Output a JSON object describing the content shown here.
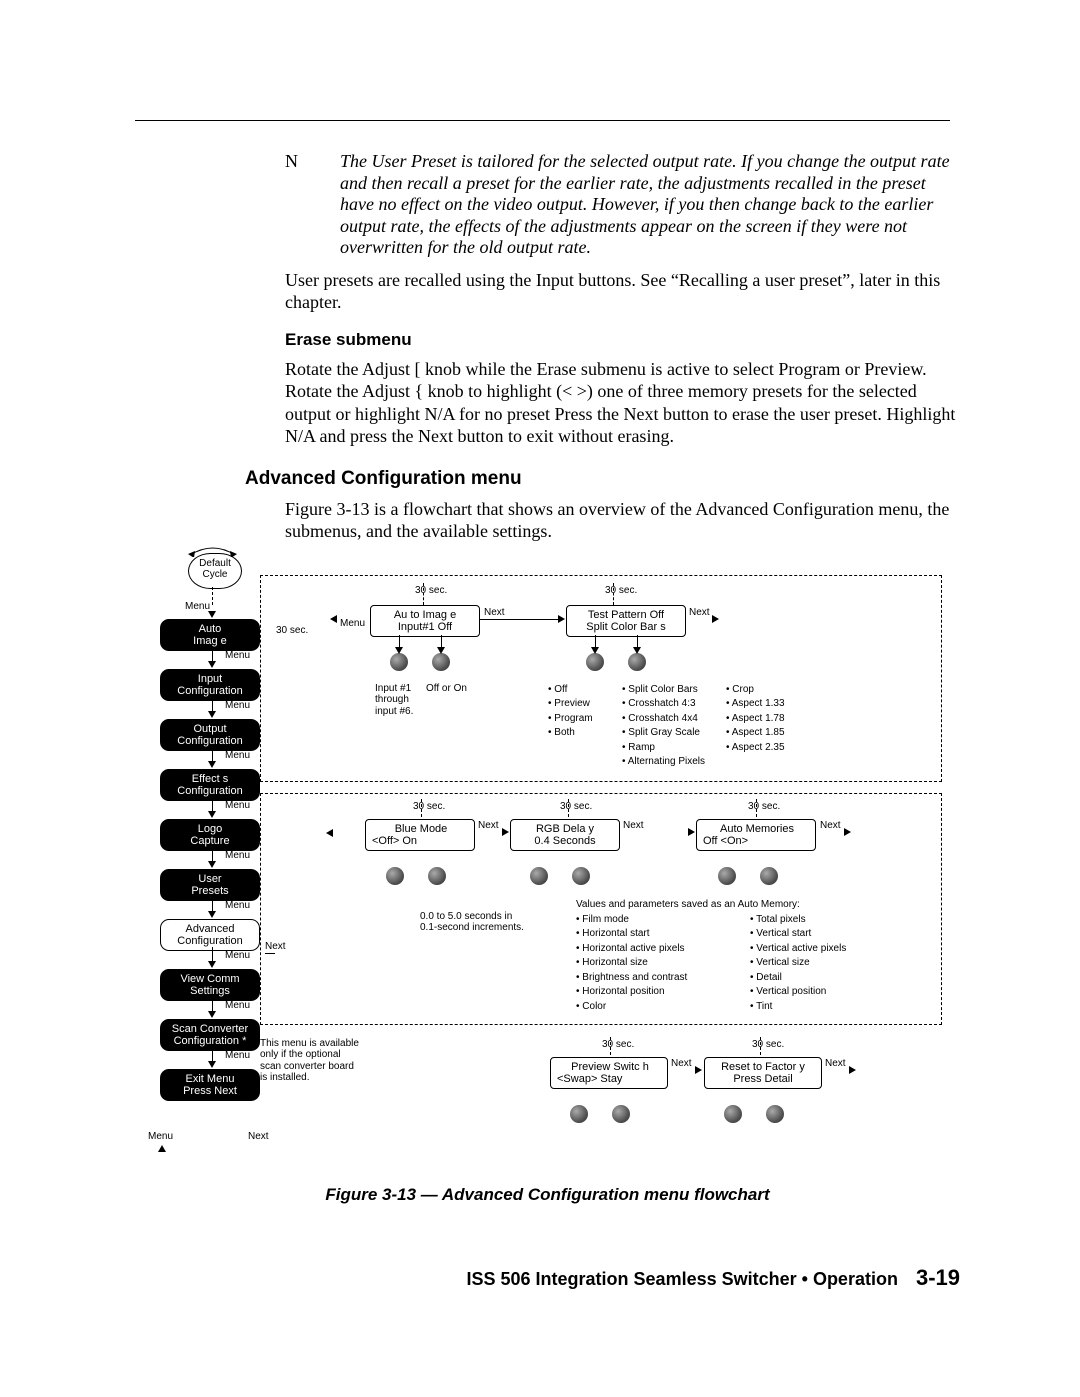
{
  "note": {
    "label": "N",
    "text": "The User Preset is tailored for the selected output rate.  If you change the output rate and then recall a preset for the earlier rate, the adjustments recalled in the preset have no effect on the video output.  However, if you then change back to the earlier output rate, the effects of the adjustments appear on the screen if they were not overwritten for the old output rate."
  },
  "para1": "User presets are recalled using the Input buttons.  See “Recalling a user preset”, later in this chapter.",
  "h4_erase": "Erase submenu",
  "para2": "Rotate the Adjust [ knob while the Erase submenu is active to select Program or Preview.  Rotate the Adjust { knob to highlight (< >) one of three memory presets for the selected output or highlight N/A for no preset  Press the Next button to erase the user preset.  Highlight N/A and press the Next button to exit without erasing.",
  "h3_adv": "Advanced Configuration menu",
  "para3": "Figure 3-13 is a flowchart that shows an overview of the Advanced Configuration menu, the submenus, and the available settings.",
  "figcap": "Figure 3-13 — Advanced Configuration menu flowchart",
  "footer": {
    "title": "ISS 506 Integration Seamless Switcher • Operation",
    "page": "3-19"
  },
  "flow": {
    "default_cycle": "Default\nCycle",
    "side_menu_items": [
      "Auto\nImag e",
      "Input\nConfiguration",
      "Output\nConfiguration",
      "Effect s\nConfiguration",
      "Logo\nCapture",
      "User\nPresets",
      "Advanced\nConfiguration",
      "View Comm\nSettings",
      "Scan Converter\nConfiguration *",
      "Exit Menu\nPress Next"
    ],
    "connect_menu": "Menu",
    "connect_next": "Next",
    "connect_30": "30 sec.",
    "box_auto_image": {
      "l1": "Au to Imag e",
      "l2": "Input#1 Off"
    },
    "box_test_pattern": {
      "l1": "Test Pattern Off",
      "l2": "Split Color Bar s"
    },
    "box_blue": {
      "l1": "Blue Mode",
      "l2": "<Off>         On"
    },
    "box_rgb": {
      "l1": "RGB Dela y",
      "l2": "0.4 Seconds"
    },
    "box_mem": {
      "l1": "Auto Memories",
      "l2": "Off          <On>"
    },
    "box_prev": {
      "l1": "Preview Switc h",
      "l2": "<Swap>      Stay"
    },
    "box_reset": {
      "l1": "Reset to Factor y",
      "l2": "Press Detail"
    },
    "annot_input16": "Input #1\nthrough\ninput #6.",
    "annot_offon": "Off or On",
    "bul_tp1": [
      "Off",
      "Preview",
      "Program",
      "Both"
    ],
    "bul_tp2": [
      "Split Color Bars",
      "Crosshatch 4:3",
      "Crosshatch 4x4",
      "Split Gray Scale",
      "Ramp",
      "Alternating Pixels"
    ],
    "bul_tp3": [
      "Crop",
      "Aspect 1.33",
      "Aspect 1.78",
      "Aspect 1.85",
      "Aspect 2.35"
    ],
    "annot_rgb_inc": "0.0 to 5.0 seconds in\n0.1-second increments.",
    "annot_mem_caption": "Values and parameters saved as an Auto Memory:",
    "bul_mem1": [
      "Film mode",
      "Horizontal start",
      "Horizontal active pixels",
      "Horizontal size",
      "Brightness and contrast",
      "Horizontal position",
      "Color"
    ],
    "bul_mem2": [
      "Total pixels",
      "Vertical start",
      "Vertical active pixels",
      "Vertical size",
      "Detail",
      "Vertical position",
      "Tint"
    ],
    "annot_sc": "This menu is available\nonly if the optional\nscan converter board\nis installed."
  }
}
